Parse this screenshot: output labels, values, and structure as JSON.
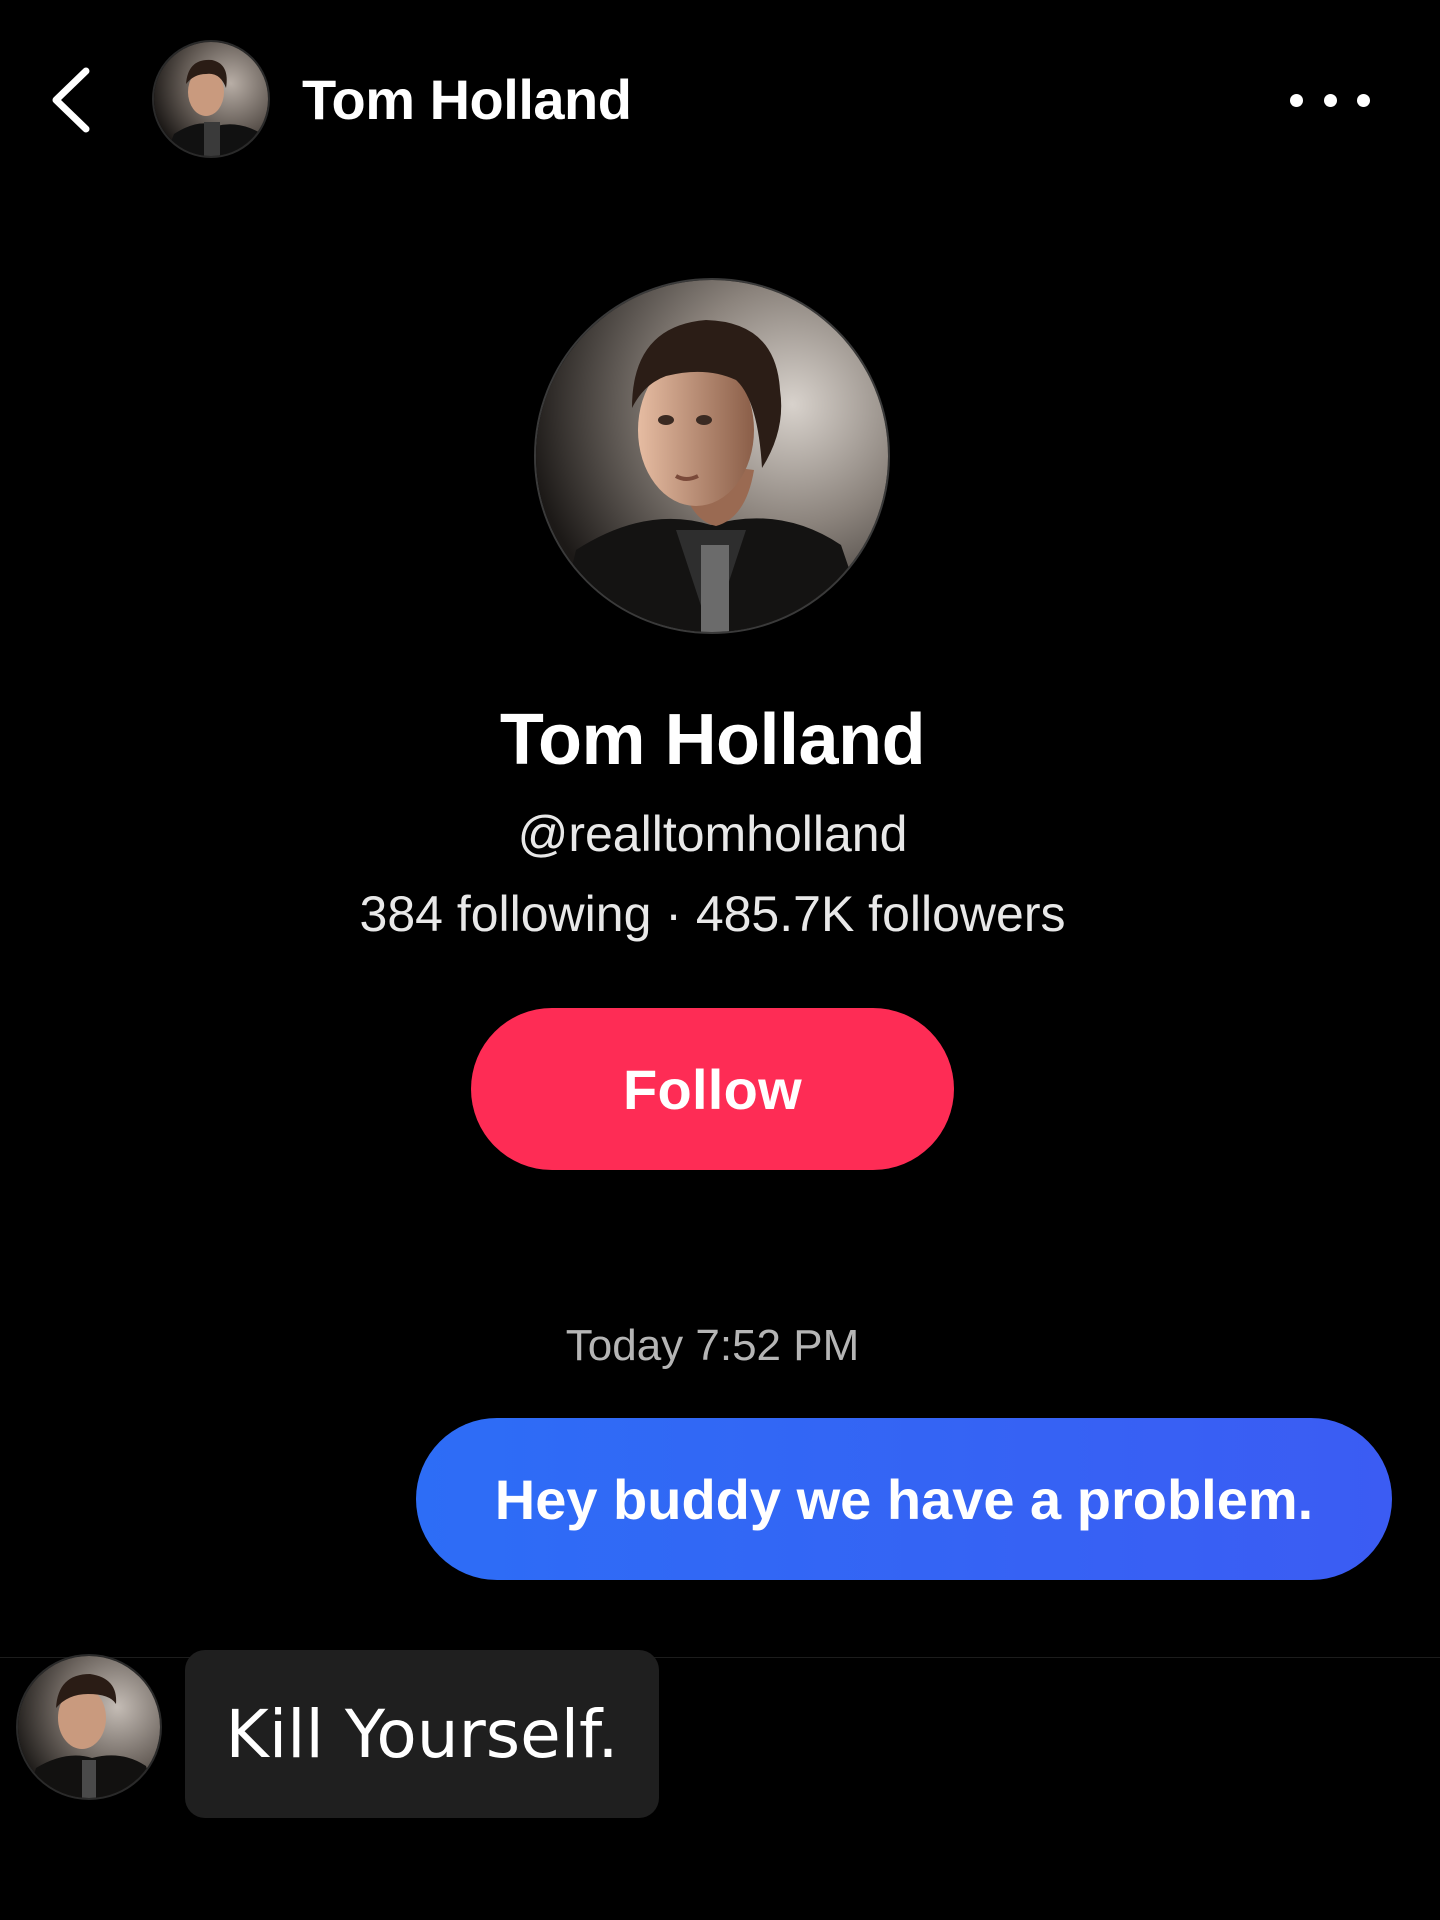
{
  "header": {
    "title": "Tom Holland",
    "back_icon": "chevron-left-icon",
    "more_icon": "more-horizontal-icon"
  },
  "profile": {
    "name": "Tom Holland",
    "handle": "@realltomholland",
    "stats": "384 following · 485.7K followers",
    "follow_label": "Follow"
  },
  "chat": {
    "timestamp": "Today 7:52 PM",
    "sent_message": "Hey buddy we have a problem.",
    "received_message": "Kill Yourself."
  },
  "colors": {
    "background": "#000000",
    "follow_button": "#fe2c55",
    "sent_bubble": "#2d6df6",
    "received_bubble": "#1f1f1f"
  }
}
